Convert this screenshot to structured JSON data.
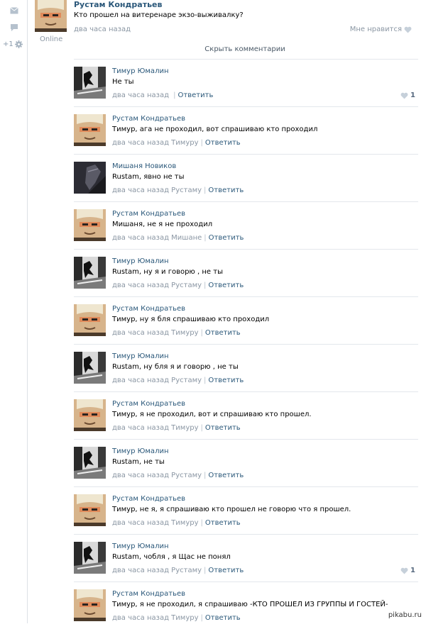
{
  "rail": {
    "counter": "+1"
  },
  "post": {
    "author": "Рустам Кондратьев",
    "text": "Кто прошел на витеренаре экзо-выживалку?",
    "time": "два часа назад",
    "like_label": "Мне нравится",
    "online": "Online"
  },
  "hide_comments": "Скрыть комментарии",
  "reply_label": "Ответить",
  "comments": [
    {
      "author": "Тимур Юмалин",
      "text": "Не ты",
      "time": "два часа назад",
      "to": "",
      "likes": "1",
      "avatar": "timur"
    },
    {
      "author": "Рустам Кондратьев",
      "text": "Тимур, ага не проходил, вот спрашиваю кто проходил",
      "time": "два часа назад",
      "to": "Тимуру",
      "likes": "",
      "avatar": "rustam"
    },
    {
      "author": "Мишаня Новиков",
      "text": "Rustam, явно не ты",
      "time": "два часа назад",
      "to": "Рустаму",
      "likes": "",
      "avatar": "mishanya"
    },
    {
      "author": "Рустам Кондратьев",
      "text": "Мишаня, не я не проходил",
      "time": "два часа назад",
      "to": "Мишане",
      "likes": "",
      "avatar": "rustam"
    },
    {
      "author": "Тимур Юмалин",
      "text": "Rustam, ну я и говорю , не ты",
      "time": "два часа назад",
      "to": "Рустаму",
      "likes": "",
      "avatar": "timur"
    },
    {
      "author": "Рустам Кондратьев",
      "text": "Тимур, ну я бля спрашиваю кто проходил",
      "time": "два часа назад",
      "to": "Тимуру",
      "likes": "",
      "avatar": "rustam"
    },
    {
      "author": "Тимур Юмалин",
      "text": "Rustam, ну бля я и говорю , не ты",
      "time": "два часа назад",
      "to": "Рустаму",
      "likes": "",
      "avatar": "timur"
    },
    {
      "author": "Рустам Кондратьев",
      "text": "Тимур, я не проходил, вот и спрашиваю кто прошел.",
      "time": "два часа назад",
      "to": "Тимуру",
      "likes": "",
      "avatar": "rustam"
    },
    {
      "author": "Тимур Юмалин",
      "text": "Rustam, не ты",
      "time": "два часа назад",
      "to": "Рустаму",
      "likes": "",
      "avatar": "timur"
    },
    {
      "author": "Рустам Кондратьев",
      "text": "Тимур, не я, я спрашиваю кто прошел не говорю что я прошел.",
      "time": "два часа назад",
      "to": "Тимуру",
      "likes": "",
      "avatar": "rustam"
    },
    {
      "author": "Тимур Юмалин",
      "text": "Rustam, чобля , я Щас не понял",
      "time": "два часа назад",
      "to": "Рустаму",
      "likes": "1",
      "avatar": "timur"
    },
    {
      "author": "Рустам Кондратьев",
      "text": "Тимур, я не проходил, я спрашиваю -КТО ПРОШЕЛ ИЗ ГРУППЫ И ГОСТЕЙ-",
      "time": "два часа назад",
      "to": "Тимуру",
      "likes": "",
      "avatar": "rustam"
    }
  ],
  "watermark": "pikabu.ru",
  "colors": {
    "link": "#2b587a",
    "meta": "#8a96a3",
    "divider": "#e3e7ec"
  }
}
